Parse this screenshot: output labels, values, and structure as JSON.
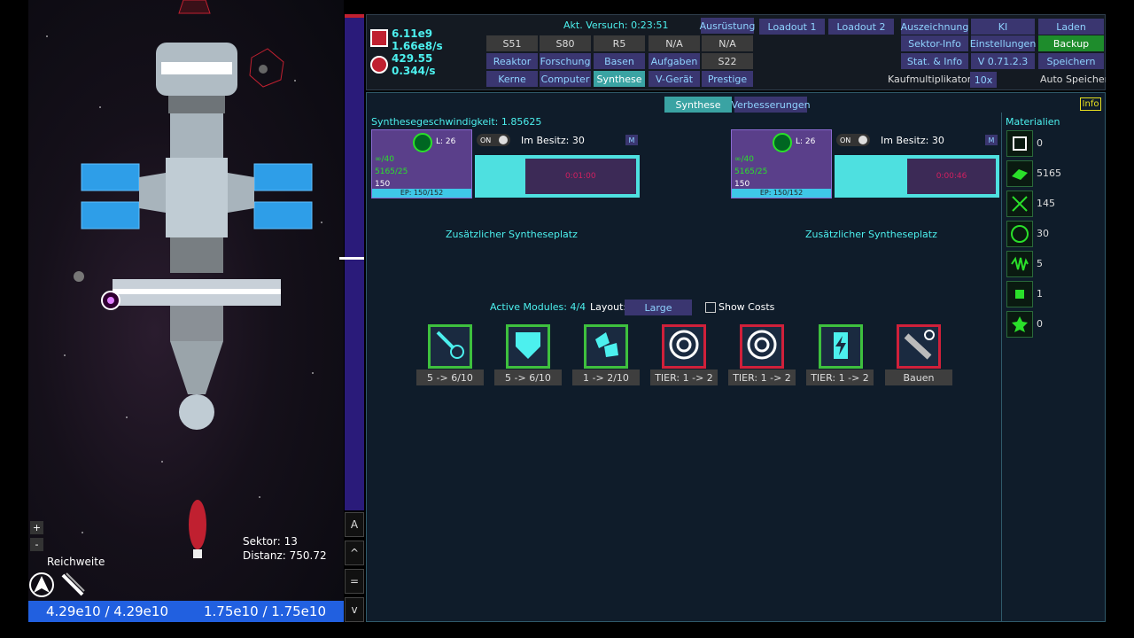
{
  "viewport": {
    "sector": "Sektor: 13",
    "distance": "Distanz: 750.72",
    "range_label": "Reichweite",
    "zoom_in": "+",
    "zoom_out": "-",
    "bottom_left": "4.29e10 / 4.29e10",
    "bottom_right": "1.75e10 / 1.75e10"
  },
  "side_buttons": [
    "A",
    "^",
    "=",
    "v"
  ],
  "stats": {
    "line1": "6.11e9",
    "line2": "1.66e8/s",
    "line3": "429.55",
    "line4": "0.344/s"
  },
  "header": {
    "attempt": "Akt. Versuch: 0:23:51",
    "kaufmulti_label": "Kaufmultiplikator:",
    "kaufmulti_value": "10x",
    "autosave": "Auto Speichern",
    "grid": [
      [
        "S51",
        "S80",
        "R5",
        "N/A",
        "N/A"
      ],
      [
        "Reaktor",
        "Forschung",
        "Basen",
        "Aufgaben",
        "S22"
      ],
      [
        "Kerne",
        "Computer",
        "Synthese",
        "V-Gerät",
        "Prestige"
      ]
    ],
    "ausruestung": "Ausrüstung",
    "loadout1": "Loadout 1",
    "loadout2": "Loadout 2",
    "right": [
      [
        "Auszeichnung",
        "KI",
        "Laden"
      ],
      [
        "Sektor-Info",
        "Einstellungen",
        "Backup"
      ],
      [
        "Stat. & Info",
        "V 0.71.2.3",
        "Speichern"
      ]
    ]
  },
  "main": {
    "tab_synthese": "Synthese",
    "tab_upgrades": "Verbesserungen",
    "info": "Info",
    "speed": "Synthesegeschwindigkeit: 1.85625",
    "materials_title": "Materialien",
    "slots": [
      {
        "level": "L: 26",
        "on": "ON",
        "owned": "Im Besitz: 30",
        "m": "M",
        "r1": "∞/40",
        "r2": "5165/25",
        "r3": "150",
        "ep": "EP: 150/152",
        "timer": "0:01:00",
        "progress": 0.3
      },
      {
        "level": "L: 26",
        "on": "ON",
        "owned": "Im Besitz: 30",
        "m": "M",
        "r1": "∞/40",
        "r2": "5165/25",
        "r3": "150",
        "ep": "EP: 150/152",
        "timer": "0:00:46",
        "progress": 0.44
      }
    ],
    "extra_slot": "Zusätzlicher Syntheseplatz",
    "active_modules": "Active Modules: 4/4",
    "layout_label": "Layout:",
    "layout_value": "Large",
    "show_costs": "Show Costs",
    "modules": [
      {
        "label": "5 -> 6/10",
        "icon": "comet-icon",
        "border": "#3ec03e"
      },
      {
        "label": "5 -> 6/10",
        "icon": "shield-icon",
        "border": "#3ec03e"
      },
      {
        "label": "1 -> 2/10",
        "icon": "crystals-icon",
        "border": "#3ec03e"
      },
      {
        "label": "TIER: 1 -> 2",
        "icon": "vortex-icon",
        "border": "#d0203a"
      },
      {
        "label": "TIER: 1 -> 2",
        "icon": "vortex-icon",
        "border": "#d0203a"
      },
      {
        "label": "TIER: 1 -> 2",
        "icon": "battery-icon",
        "border": "#3ec03e"
      },
      {
        "label": "Bauen",
        "icon": "build-icon",
        "border": "#d0203a"
      }
    ],
    "materials": [
      "0",
      "5165",
      "145",
      "30",
      "5",
      "1",
      "0"
    ]
  }
}
